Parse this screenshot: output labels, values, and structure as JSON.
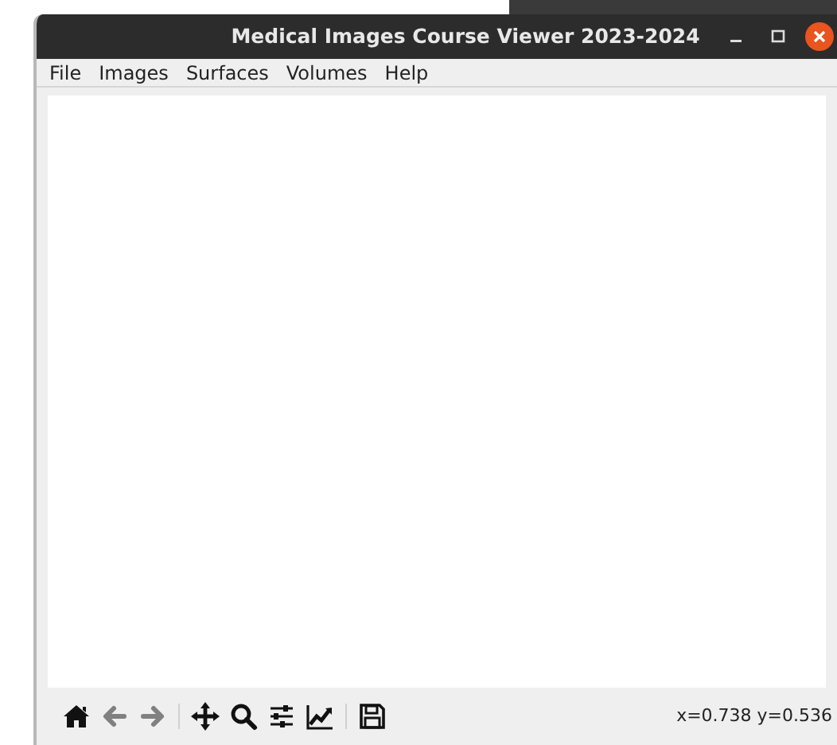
{
  "window": {
    "title": "Medical Images Course Viewer 2023-2024"
  },
  "menu": [
    "File",
    "Images",
    "Surfaces",
    "Volumes",
    "Help"
  ],
  "toolbar": [
    {
      "kind": "home",
      "disabled": false
    },
    {
      "kind": "back",
      "disabled": true
    },
    {
      "kind": "forward",
      "disabled": true
    },
    {
      "kind": "pan",
      "disabled": false
    },
    {
      "kind": "zoom",
      "disabled": false
    },
    {
      "kind": "subplots",
      "disabled": false
    },
    {
      "kind": "axes",
      "disabled": false
    },
    {
      "kind": "save",
      "disabled": false
    }
  ],
  "status": "x=0.738 y=0.536"
}
